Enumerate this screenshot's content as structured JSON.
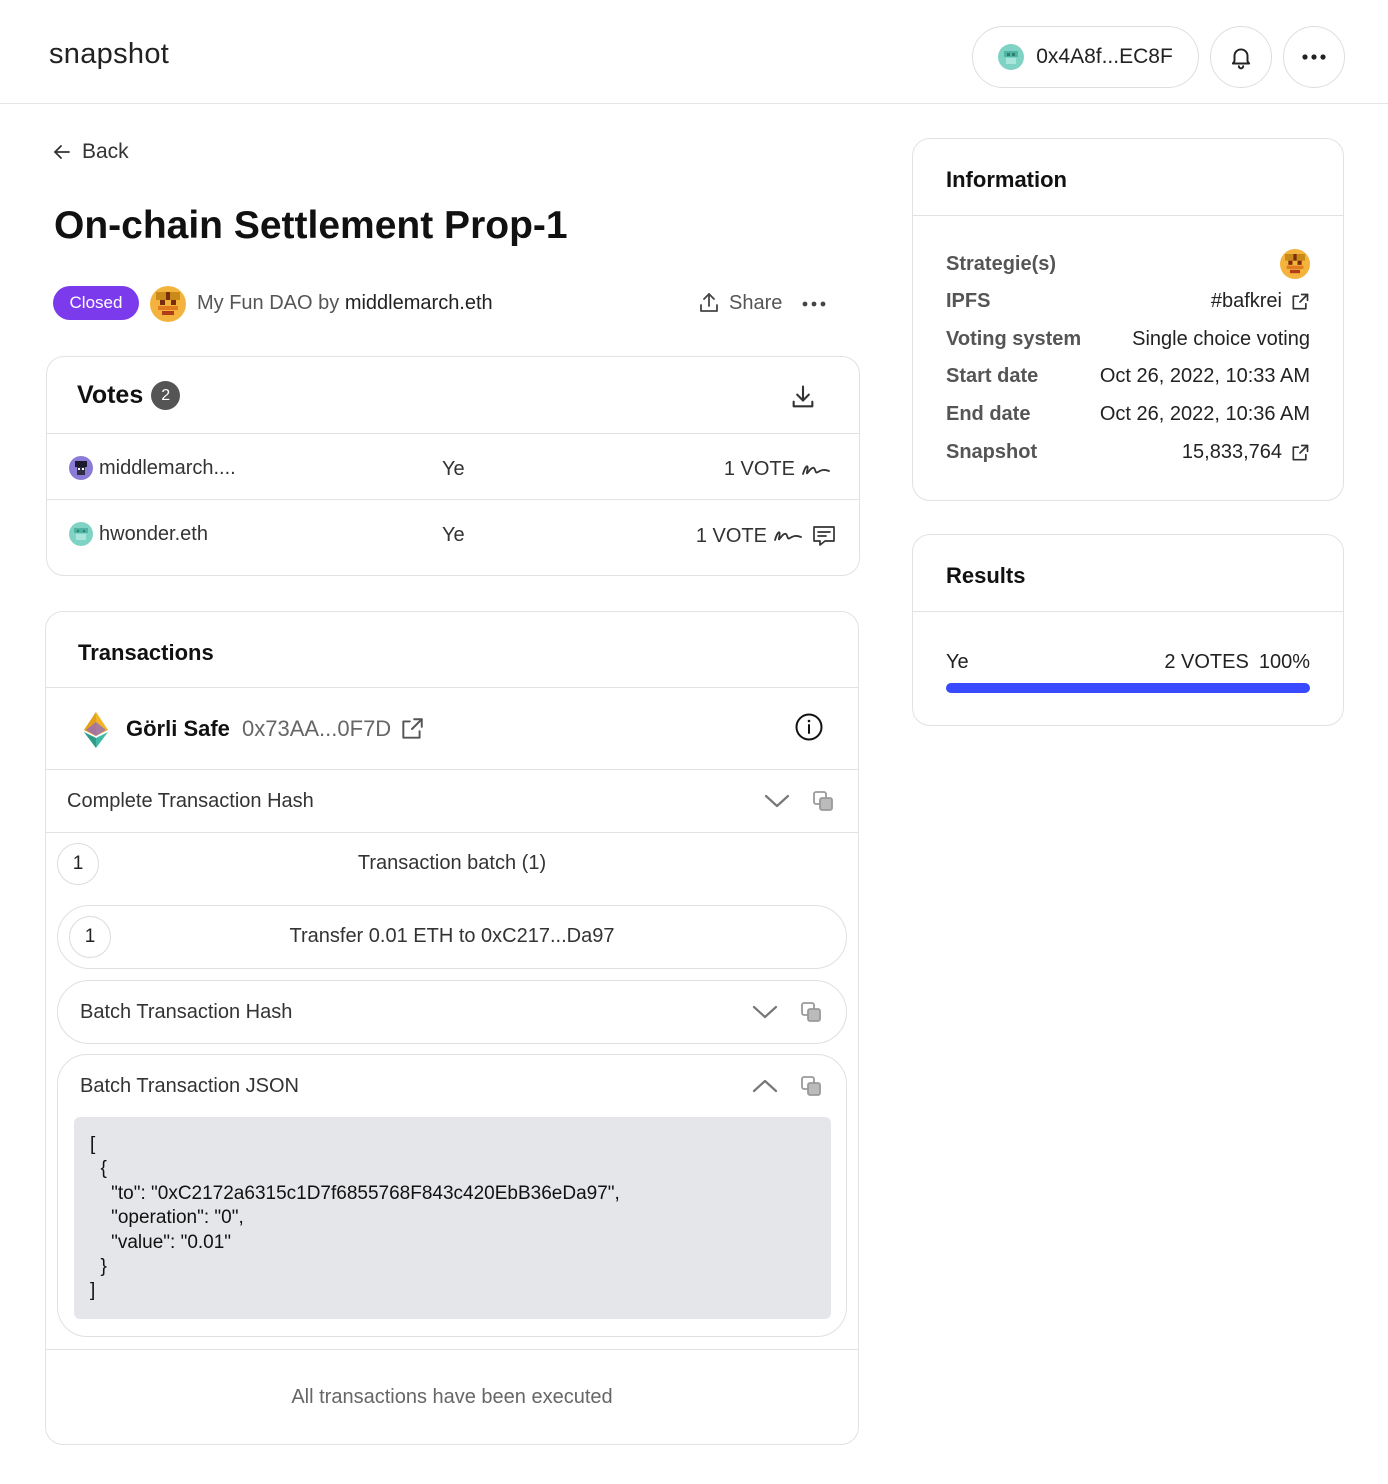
{
  "header": {
    "logo": "snapshot",
    "account_address": "0x4A8f...EC8F"
  },
  "nav": {
    "back_label": "Back"
  },
  "proposal": {
    "title": "On-chain Settlement Prop-1",
    "state": "Closed",
    "space": "My Fun DAO",
    "by": "by",
    "author": "middlemarch.eth",
    "share_label": "Share"
  },
  "votes": {
    "title": "Votes",
    "count": "2",
    "rows": [
      {
        "voter": "middlemarch....",
        "choice": "Ye",
        "power": "1 VOTE"
      },
      {
        "voter": "hwonder.eth",
        "choice": "Ye",
        "power": "1 VOTE"
      }
    ]
  },
  "transactions": {
    "title": "Transactions",
    "safe_name": "Görli Safe",
    "safe_address": "0x73AA...0F7D",
    "complete_hash_label": "Complete Transaction Hash",
    "batch_number": "1",
    "batch_label": "Transaction batch (1)",
    "tx_number": "1",
    "transfer_label": "Transfer 0.01 ETH to 0xC217...Da97",
    "batch_hash_label": "Batch Transaction Hash",
    "batch_json_label": "Batch Transaction JSON",
    "batch_json": "[\n  {\n    \"to\": \"0xC2172a6315c1D7f6855768F843c420EbB36eDa97\",\n    \"operation\": \"0\",\n    \"value\": \"0.01\"\n  }\n]",
    "executed_text": "All transactions have been executed"
  },
  "information": {
    "title": "Information",
    "strategies_label": "Strategie(s)",
    "ipfs_label": "IPFS",
    "ipfs_value": "#bafkrei",
    "voting_system_label": "Voting system",
    "voting_system_value": "Single choice voting",
    "start_label": "Start date",
    "start_value": "Oct 26, 2022, 10:33 AM",
    "end_label": "End date",
    "end_value": "Oct 26, 2022, 10:36 AM",
    "snapshot_label": "Snapshot",
    "snapshot_value": "15,833,764"
  },
  "results": {
    "title": "Results",
    "choice": "Ye",
    "votes": "2 VOTES",
    "percent": "100%",
    "fraction": 1.0,
    "bar_color": "#384aff"
  },
  "colors": {
    "closed_badge": "#7c3aed",
    "vote_bar": "#384aff"
  }
}
